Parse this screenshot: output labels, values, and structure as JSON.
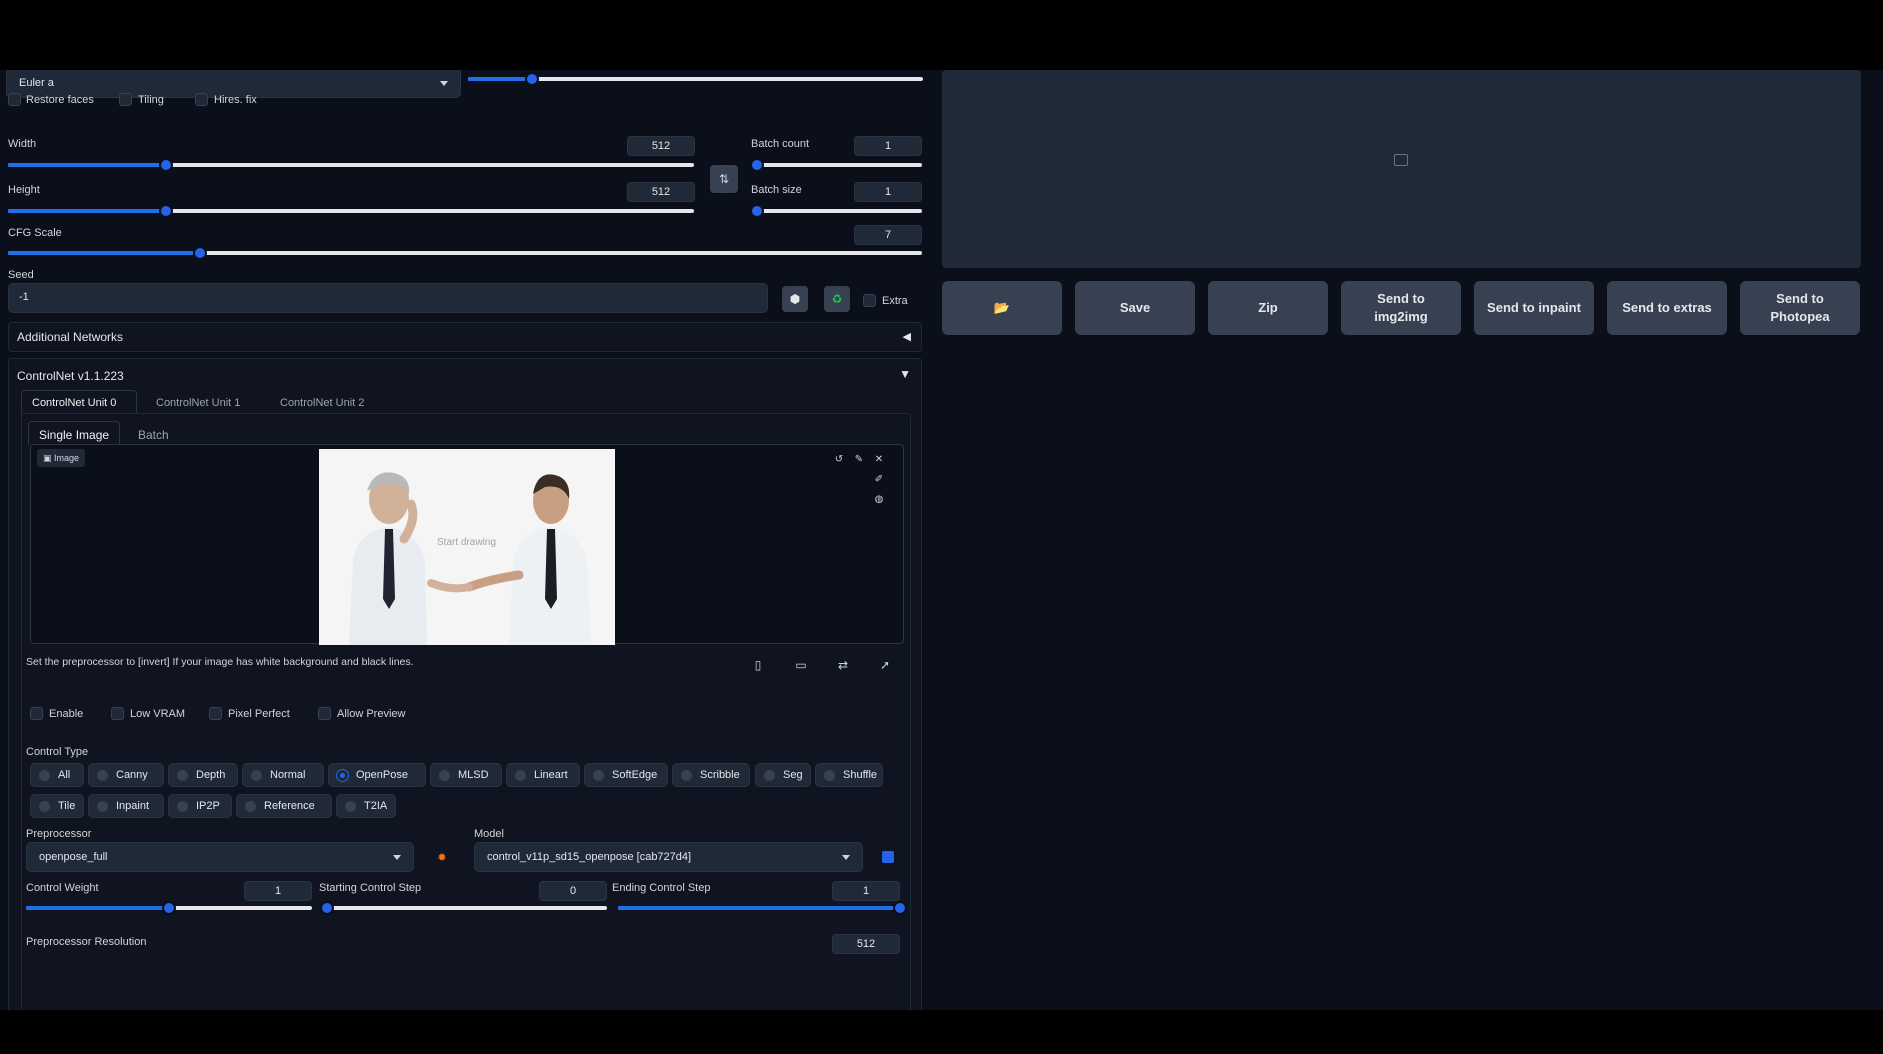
{
  "sampler": {
    "value": "Euler a",
    "steps_fraction": 0.14
  },
  "options": {
    "restore_faces": "Restore faces",
    "tiling": "Tiling",
    "hires_fix": "Hires. fix"
  },
  "width": {
    "label": "Width",
    "value": "512",
    "fraction": 0.23
  },
  "height": {
    "label": "Height",
    "value": "512",
    "fraction": 0.23
  },
  "batch_count": {
    "label": "Batch count",
    "value": "1",
    "fraction": 0.0
  },
  "batch_size": {
    "label": "Batch size",
    "value": "1",
    "fraction": 0.0
  },
  "cfg": {
    "label": "CFG Scale",
    "value": "7",
    "fraction": 0.21
  },
  "seed": {
    "label": "Seed",
    "value": "-1",
    "extra_label": "Extra"
  },
  "additional_networks": {
    "title": "Additional Networks",
    "arrow": "◀"
  },
  "controlnet": {
    "title": "ControlNet v1.1.223",
    "arrow": "▼",
    "units": [
      "ControlNet Unit 0",
      "ControlNet Unit 1",
      "ControlNet Unit 2"
    ],
    "subtabs": [
      "Single Image",
      "Batch"
    ],
    "image_label": "Image",
    "canvas_hint": "Start drawing",
    "hint": "Set the preprocessor to [invert] If your image has white background and black lines.",
    "checks": {
      "enable": "Enable",
      "low_vram": "Low VRAM",
      "pixel_perfect": "Pixel Perfect",
      "allow_preview": "Allow Preview"
    },
    "control_type_label": "Control Type",
    "control_types_row1": [
      "All",
      "Canny",
      "Depth",
      "Normal",
      "OpenPose",
      "MLSD",
      "Lineart",
      "SoftEdge",
      "Scribble",
      "Seg",
      "Shuffle"
    ],
    "control_types_row2": [
      "Tile",
      "Inpaint",
      "IP2P",
      "Reference",
      "T2IA"
    ],
    "selected_type": "OpenPose",
    "preprocessor_label": "Preprocessor",
    "preprocessor_value": "openpose_full",
    "model_label": "Model",
    "model_value": "control_v11p_sd15_openpose [cab727d4]",
    "control_weight": {
      "label": "Control Weight",
      "value": "1",
      "fraction": 0.5
    },
    "start_step": {
      "label": "Starting Control Step",
      "value": "0",
      "fraction": 0.0
    },
    "end_step": {
      "label": "Ending Control Step",
      "value": "1",
      "fraction": 1.0
    },
    "preproc_res": {
      "label": "Preprocessor Resolution",
      "value": "512"
    }
  },
  "output_buttons": {
    "folder": "📂",
    "save": "Save",
    "zip": "Zip",
    "img2img": "Send to img2img",
    "inpaint": "Send to inpaint",
    "extras": "Send to extras",
    "photopea": "Send to Photopea"
  },
  "colors": {
    "accent": "#2563eb",
    "background": "#0b0f19",
    "button": "#374151"
  }
}
